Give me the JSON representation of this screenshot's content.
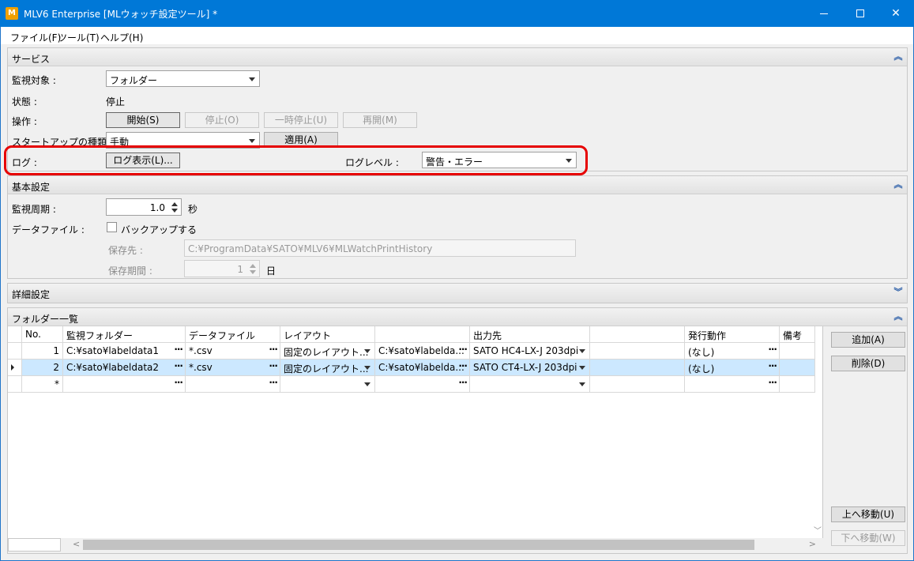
{
  "window": {
    "icon_text": "M",
    "title": "MLV6 Enterprise [MLウォッチ設定ツール] *"
  },
  "menu": [
    "ファイル(F)",
    "ツール(T)",
    "ヘルプ(H)"
  ],
  "service": {
    "title": "サービス",
    "monitor_target_label": "監視対象 :",
    "monitor_target_value": "フォルダー",
    "state_label": "状態 :",
    "state_value": "停止",
    "operation_label": "操作 :",
    "buttons": {
      "start": "開始(S)",
      "stop": "停止(O)",
      "pause": "一時停止(U)",
      "resume": "再開(M)"
    },
    "startup_label": "スタートアップの種類 :",
    "startup_value": "手動",
    "apply_button": "適用(A)",
    "log_label": "ログ :",
    "log_view_button": "ログ表示(L)...",
    "log_level_label": "ログレベル :",
    "log_level_value": "警告・エラー"
  },
  "basic": {
    "title": "基本設定",
    "period_label": "監視周期 :",
    "period_value": "1.0",
    "period_unit": "秒",
    "datafile_label": "データファイル :",
    "backup_label": "バックアップする",
    "backup_checked": false,
    "save_to_label": "保存先 :",
    "save_to_value": "C:¥ProgramData¥SATO¥MLV6¥MLWatchPrintHistory",
    "retention_label": "保存期間 :",
    "retention_value": "1",
    "retention_unit": "日"
  },
  "advanced": {
    "title": "詳細設定"
  },
  "folders": {
    "title": "フォルダー一覧",
    "columns": [
      "No.",
      "監視フォルダー",
      "データファイル",
      "レイアウト",
      "",
      "出力先",
      "",
      "発行動作",
      "備考"
    ],
    "rows": [
      {
        "no": "1",
        "folder": "C:¥sato¥labeldata1",
        "datafile": "*.csv",
        "layout": "固定のレイアウト...",
        "layout_path": "C:¥sato¥labelda...",
        "output": "SATO HC4-LX-J 203dpi",
        "action": "(なし)",
        "selected": false
      },
      {
        "no": "2",
        "folder": "C:¥sato¥labeldata2",
        "datafile": "*.csv",
        "layout": "固定のレイアウト...",
        "layout_path": "C:¥sato¥labelda...",
        "output": "SATO CT4-LX-J 203dpi",
        "action": "(なし)",
        "selected": true
      }
    ],
    "new_row_marker": "*",
    "buttons": {
      "add": "追加(A)",
      "delete": "削除(D)",
      "move_up": "上へ移動(U)",
      "move_down": "下へ移動(W)"
    }
  }
}
